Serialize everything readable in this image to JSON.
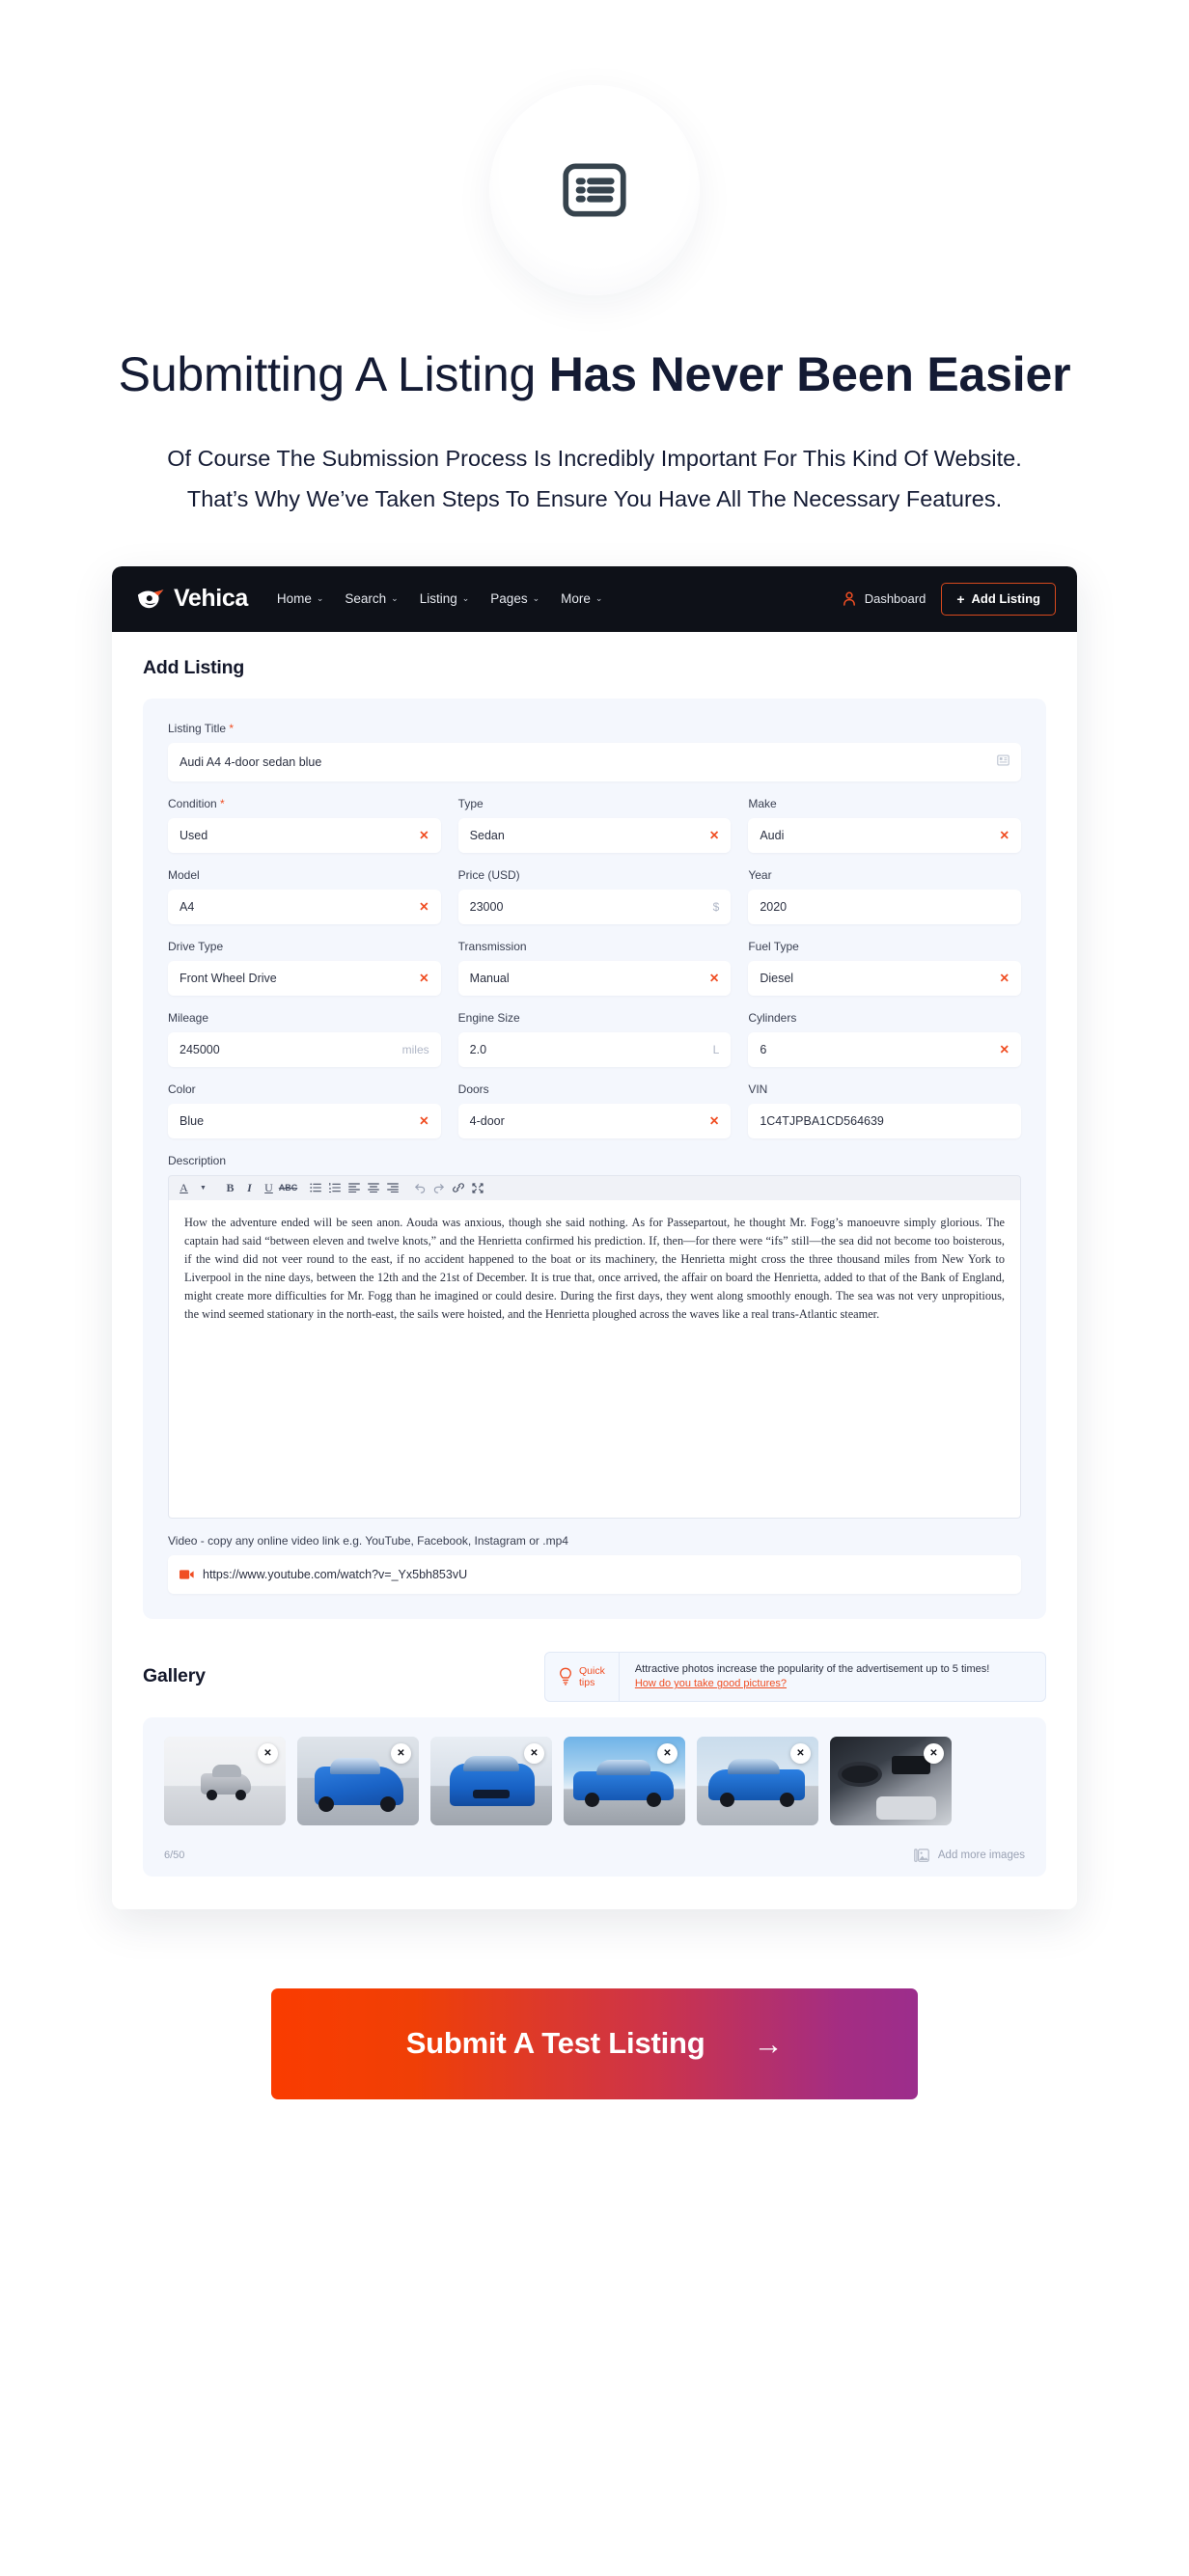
{
  "hero": {
    "icon": "list-square-icon",
    "title_light": "Submitting A Listing ",
    "title_bold": "Has Never Been Easier",
    "subtitle": "Of Course The Submission Process Is Incredibly Important For This Kind Of Website. That’s Why We’ve Taken Steps To Ensure You Have All The Necessary Features."
  },
  "navbar": {
    "brand": "Vehica",
    "links": [
      {
        "label": "Home",
        "caret": "⌄"
      },
      {
        "label": "Search",
        "caret": "⌄"
      },
      {
        "label": "Listing",
        "caret": "⌄"
      },
      {
        "label": "Pages",
        "caret": "⌄"
      },
      {
        "label": "More",
        "caret": "⌄"
      }
    ],
    "dashboard": "Dashboard",
    "add_listing": "Add Listing",
    "plus": "+"
  },
  "page": {
    "title": "Add Listing"
  },
  "form": {
    "listing_title": {
      "label": "Listing Title",
      "required": "*",
      "value": "Audi A4 4-door sedan blue",
      "icon": "template-icon"
    },
    "fields": [
      {
        "label": "Condition",
        "required": "*",
        "value": "Used",
        "clear": "✕"
      },
      {
        "label": "Type",
        "value": "Sedan",
        "clear": "✕"
      },
      {
        "label": "Make",
        "value": "Audi",
        "clear": "✕"
      },
      {
        "label": "Model",
        "value": "A4",
        "clear": "✕"
      },
      {
        "label": "Price (USD)",
        "value": "23000",
        "suffix": "$"
      },
      {
        "label": "Year",
        "value": "2020"
      },
      {
        "label": "Drive Type",
        "value": "Front Wheel Drive",
        "clear": "✕"
      },
      {
        "label": "Transmission",
        "value": "Manual",
        "clear": "✕"
      },
      {
        "label": "Fuel Type",
        "value": "Diesel",
        "clear": "✕"
      },
      {
        "label": "Mileage",
        "value": "245000",
        "suffix": "miles"
      },
      {
        "label": "Engine Size",
        "value": "2.0",
        "suffix": "L"
      },
      {
        "label": "Cylinders",
        "value": "6",
        "clear": "✕"
      },
      {
        "label": "Color",
        "value": "Blue",
        "clear": "✕"
      },
      {
        "label": "Doors",
        "value": "4-door",
        "clear": "✕"
      },
      {
        "label": "VIN",
        "value": "1C4TJPBA1CD564639"
      }
    ],
    "description": {
      "label": "Description",
      "toolbar": [
        "font-color-icon",
        "chevron-down-icon",
        "bold-icon",
        "italic-icon",
        "underline-icon",
        "strikethrough-icon",
        "bullet-list-icon",
        "numbered-list-icon",
        "align-left-icon",
        "align-center-icon",
        "align-right-icon",
        "undo-icon",
        "redo-icon",
        "link-icon",
        "fullscreen-icon"
      ],
      "text": "How the adventure ended will be seen anon. Aouda was anxious, though she said nothing. As for Passepartout, he thought Mr. Fogg’s manoeuvre simply glorious. The captain had said “between eleven and twelve knots,” and the Henrietta confirmed his prediction. If, then—for there were “ifs” still—the sea did not become too boisterous, if the wind did not veer round to the east, if no accident happened to the boat or its machinery, the Henrietta might cross the three thousand miles from New York to Liverpool in the nine days, between the 12th and the 21st of December. It is true that, once arrived, the affair on board the Henrietta, added to that of the Bank of England, might create more difficulties for Mr. Fogg than he imagined or could desire. During the first days, they went along smoothly enough. The sea was not very unpropitious, the wind seemed stationary in the north-east, the sails were hoisted, and the Henrietta ploughed across the waves like a real trans-Atlantic steamer."
    },
    "video": {
      "label": "Video - copy any online video link e.g. YouTube, Facebook, Instagram or .mp4",
      "value": "https://www.youtube.com/watch?v=_Yx5bh853vU",
      "icon": "video-icon"
    }
  },
  "gallery": {
    "title": "Gallery",
    "tips_badge_line1": "Quick",
    "tips_badge_line2": "tips",
    "tips_icon": "bulb-icon",
    "tips_text": "Attractive photos increase the popularity of the advertisement up to 5 times!",
    "tips_link": "How do you take good pictures?",
    "images": [
      {
        "alt": "audi-grey-front-quarter",
        "remove": "✕"
      },
      {
        "alt": "audi-blue-front-quarter",
        "remove": "✕"
      },
      {
        "alt": "audi-blue-front",
        "remove": "✕"
      },
      {
        "alt": "audi-blue-side-mountain",
        "remove": "✕"
      },
      {
        "alt": "audi-blue-rear-quarter",
        "remove": "✕"
      },
      {
        "alt": "audi-interior-dashboard",
        "remove": "✕"
      }
    ],
    "count": "6/50",
    "add_more": "Add more images",
    "add_more_icon": "images-icon"
  },
  "submit": {
    "label": "Submit A Test Listing",
    "arrow": "→"
  },
  "colors": {
    "accent_orange": "#F04E23",
    "navy": "#141B34",
    "navbar_bg": "#0E1118",
    "card_bg": "#F4F7FD",
    "gradient_from": "#FA3C00",
    "gradient_to": "#9C2D8C"
  }
}
